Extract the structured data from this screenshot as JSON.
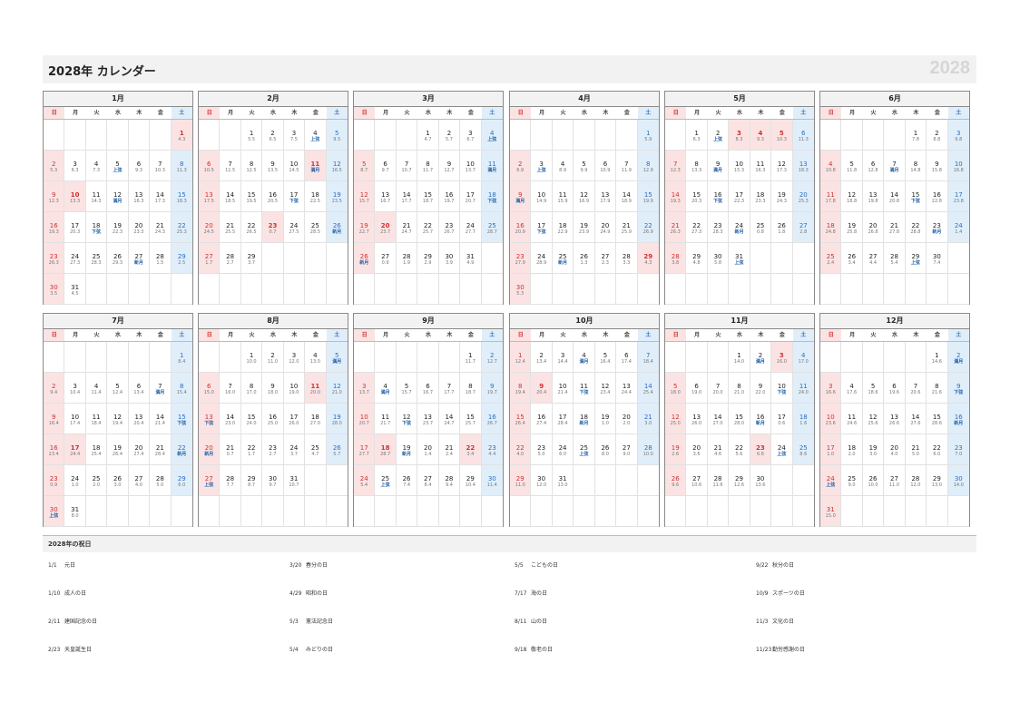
{
  "header": {
    "title": "2028年 カレンダー",
    "year": "2028"
  },
  "weekdays": [
    "日",
    "月",
    "火",
    "水",
    "木",
    "金",
    "土"
  ],
  "months": [
    {
      "label": "1月",
      "offset": 6,
      "days": 31,
      "sub": [
        "4.3",
        "5.3",
        "6.3",
        "7.3",
        "上弦",
        "9.3",
        "10.3",
        "11.3",
        "12.3",
        "13.3",
        "14.3",
        "満月",
        "16.3",
        "17.3",
        "18.3",
        "19.3",
        "20.3",
        "下弦",
        "22.3",
        "23.3",
        "24.3",
        "25.3",
        "26.3",
        "27.3",
        "28.3",
        "29.3",
        "新月",
        "1.5",
        "2.5",
        "3.5",
        "4.5"
      ],
      "holidays": [
        1,
        10
      ]
    },
    {
      "label": "2月",
      "offset": 2,
      "days": 29,
      "sub": [
        "5.5",
        "6.5",
        "7.5",
        "上弦",
        "9.5",
        "10.5",
        "11.5",
        "12.5",
        "13.5",
        "14.5",
        "満月",
        "16.5",
        "17.5",
        "18.5",
        "19.5",
        "20.5",
        "下弦",
        "22.5",
        "23.5",
        "24.5",
        "25.5",
        "26.5",
        "0.7",
        "27.5",
        "28.5",
        "新月",
        "1.7",
        "2.7",
        "3.7"
      ],
      "holidays": [
        11,
        23
      ]
    },
    {
      "label": "3月",
      "offset": 3,
      "days": 31,
      "sub": [
        "4.7",
        "5.7",
        "6.7",
        "上弦",
        "8.7",
        "9.7",
        "10.7",
        "11.7",
        "12.7",
        "13.7",
        "満月",
        "15.7",
        "16.7",
        "17.7",
        "18.7",
        "19.7",
        "20.7",
        "下弦",
        "22.7",
        "23.7",
        "24.7",
        "25.7",
        "26.7",
        "27.7",
        "28.7",
        "新月",
        "0.9",
        "1.9",
        "2.9",
        "3.9",
        "4.9"
      ],
      "holidays": [
        20
      ]
    },
    {
      "label": "4月",
      "offset": 6,
      "days": 30,
      "sub": [
        "5.9",
        "6.9",
        "上弦",
        "8.9",
        "9.9",
        "10.9",
        "11.9",
        "12.9",
        "満月",
        "14.9",
        "15.9",
        "16.9",
        "17.9",
        "18.9",
        "19.9",
        "20.9",
        "下弦",
        "22.9",
        "23.9",
        "24.9",
        "25.9",
        "26.9",
        "27.9",
        "28.9",
        "新月",
        "1.3",
        "2.3",
        "3.3",
        "4.3",
        "5.3"
      ],
      "holidays": [
        29
      ]
    },
    {
      "label": "5月",
      "offset": 1,
      "days": 31,
      "sub": [
        "6.3",
        "上弦",
        "8.3",
        "9.3",
        "10.3",
        "11.3",
        "12.3",
        "13.3",
        "満月",
        "15.3",
        "16.3",
        "17.3",
        "18.3",
        "19.3",
        "20.3",
        "下弦",
        "22.3",
        "23.3",
        "24.3",
        "25.3",
        "26.3",
        "27.3",
        "28.3",
        "新月",
        "0.8",
        "1.8",
        "2.8",
        "3.8",
        "4.8",
        "5.8",
        "上弦"
      ],
      "holidays": [
        3,
        4,
        5
      ]
    },
    {
      "label": "6月",
      "offset": 4,
      "days": 30,
      "sub": [
        "7.8",
        "8.8",
        "9.8",
        "10.8",
        "11.8",
        "12.8",
        "満月",
        "14.8",
        "15.8",
        "16.8",
        "17.8",
        "18.8",
        "19.8",
        "20.8",
        "下弦",
        "22.8",
        "23.8",
        "24.8",
        "25.8",
        "26.8",
        "27.8",
        "28.8",
        "新月",
        "1.4",
        "2.4",
        "3.4",
        "4.4",
        "5.4",
        "上弦",
        "7.4"
      ],
      "holidays": []
    },
    {
      "label": "7月",
      "offset": 6,
      "days": 31,
      "sub": [
        "8.4",
        "9.4",
        "10.4",
        "11.4",
        "12.4",
        "13.4",
        "満月",
        "15.4",
        "16.4",
        "17.4",
        "18.4",
        "19.4",
        "20.4",
        "21.4",
        "下弦",
        "23.4",
        "24.4",
        "25.4",
        "26.4",
        "27.4",
        "28.4",
        "新月",
        "0.9",
        "1.0",
        "2.0",
        "3.0",
        "4.0",
        "5.0",
        "6.0",
        "上弦",
        "8.0",
        "9.0"
      ],
      "holidays": [
        17
      ]
    },
    {
      "label": "8月",
      "offset": 2,
      "days": 31,
      "sub": [
        "10.0",
        "11.0",
        "12.0",
        "13.0",
        "満月",
        "15.0",
        "16.0",
        "17.0",
        "18.0",
        "19.0",
        "20.0",
        "21.0",
        "下弦",
        "23.0",
        "24.0",
        "25.0",
        "26.0",
        "27.0",
        "28.0",
        "新月",
        "0.7",
        "1.7",
        "2.7",
        "3.7",
        "4.7",
        "5.7",
        "上弦",
        "7.7",
        "8.7",
        "9.7",
        "10.7"
      ],
      "holidays": [
        11
      ]
    },
    {
      "label": "9月",
      "offset": 5,
      "days": 30,
      "sub": [
        "11.7",
        "12.7",
        "13.7",
        "満月",
        "15.7",
        "16.7",
        "17.7",
        "18.7",
        "19.7",
        "20.7",
        "21.7",
        "下弦",
        "23.7",
        "24.7",
        "25.7",
        "26.7",
        "27.7",
        "28.7",
        "新月",
        "1.4",
        "2.4",
        "3.4",
        "4.4",
        "5.4",
        "上弦",
        "7.4",
        "8.4",
        "9.4",
        "10.4",
        "11.4"
      ],
      "holidays": [
        18,
        22
      ]
    },
    {
      "label": "10月",
      "offset": 0,
      "days": 31,
      "sub": [
        "12.4",
        "13.4",
        "14.4",
        "満月",
        "16.4",
        "17.4",
        "18.4",
        "19.4",
        "20.4",
        "21.4",
        "下弦",
        "23.4",
        "24.4",
        "25.4",
        "26.4",
        "27.4",
        "28.4",
        "新月",
        "1.0",
        "2.0",
        "3.0",
        "4.0",
        "5.0",
        "6.0",
        "上弦",
        "8.0",
        "9.0",
        "10.0",
        "11.0",
        "12.0",
        "13.0"
      ],
      "holidays": [
        9
      ]
    },
    {
      "label": "11月",
      "offset": 3,
      "days": 30,
      "sub": [
        "14.0",
        "満月",
        "16.0",
        "17.0",
        "18.0",
        "19.0",
        "20.0",
        "21.0",
        "22.0",
        "下弦",
        "24.0",
        "25.0",
        "26.0",
        "27.0",
        "28.0",
        "新月",
        "0.6",
        "1.6",
        "2.6",
        "3.6",
        "4.6",
        "5.6",
        "6.6",
        "上弦",
        "8.6",
        "9.6",
        "10.6",
        "11.6",
        "12.6",
        "13.6"
      ],
      "holidays": [
        3,
        23
      ]
    },
    {
      "label": "12月",
      "offset": 5,
      "days": 31,
      "sub": [
        "14.6",
        "満月",
        "16.6",
        "17.6",
        "18.6",
        "19.6",
        "20.6",
        "21.6",
        "下弦",
        "23.6",
        "24.6",
        "25.6",
        "26.6",
        "27.6",
        "28.6",
        "新月",
        "1.0",
        "2.0",
        "3.0",
        "4.0",
        "5.0",
        "6.0",
        "7.0",
        "上弦",
        "9.0",
        "10.0",
        "11.0",
        "12.0",
        "13.0",
        "14.0",
        "15.0"
      ],
      "holidays": []
    }
  ],
  "holiday_section": {
    "title": "2028年の祝日",
    "items": [
      {
        "date": "1/1",
        "name": "元日"
      },
      {
        "date": "1/10",
        "name": "成人の日"
      },
      {
        "date": "2/11",
        "name": "建国記念の日"
      },
      {
        "date": "2/23",
        "name": "天皇誕生日"
      },
      {
        "date": "3/20",
        "name": "春分の日"
      },
      {
        "date": "4/29",
        "name": "昭和の日"
      },
      {
        "date": "5/3",
        "name": "憲法記念日"
      },
      {
        "date": "5/4",
        "name": "みどりの日"
      },
      {
        "date": "5/5",
        "name": "こどもの日"
      },
      {
        "date": "7/17",
        "name": "海の日"
      },
      {
        "date": "8/11",
        "name": "山の日"
      },
      {
        "date": "9/18",
        "name": "敬老の日"
      },
      {
        "date": "9/22",
        "name": "秋分の日"
      },
      {
        "date": "10/9",
        "name": "スポーツの日"
      },
      {
        "date": "11/3",
        "name": "文化の日"
      },
      {
        "date": "11/23",
        "name": "勤労感謝の日"
      }
    ]
  }
}
